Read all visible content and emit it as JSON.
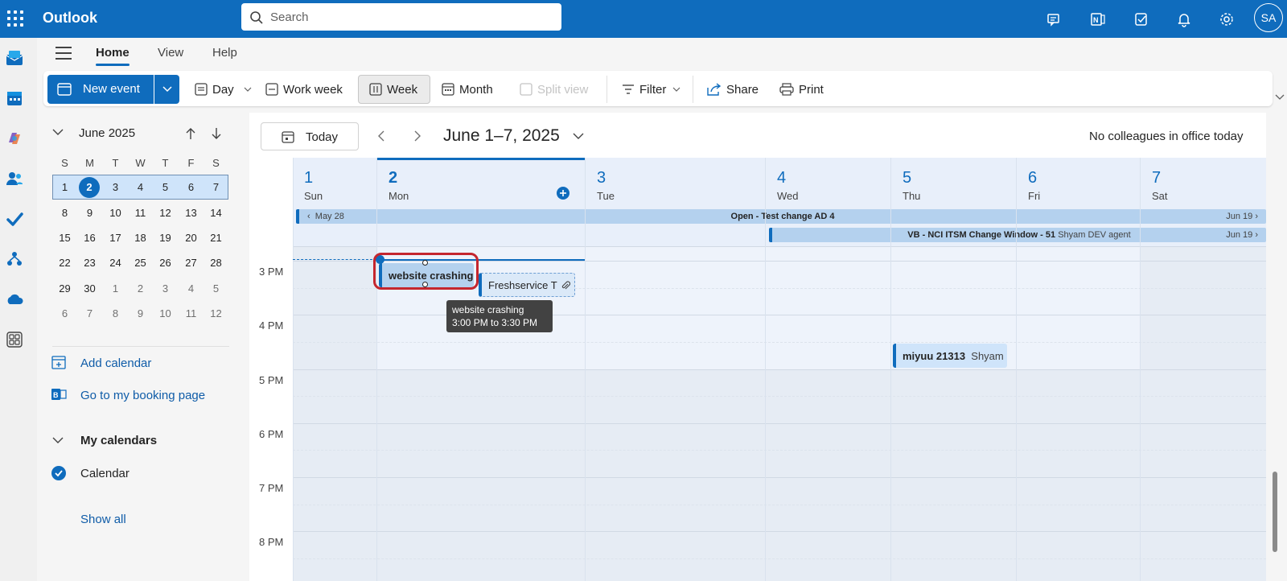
{
  "app": {
    "name": "Outlook",
    "user_initials": "SA"
  },
  "search": {
    "placeholder": "Search"
  },
  "menu": {
    "tabs": [
      "Home",
      "View",
      "Help"
    ],
    "active": "Home"
  },
  "ribbon": {
    "new_event": "New event",
    "day": "Day",
    "work_week": "Work week",
    "week": "Week",
    "month": "Month",
    "split_view": "Split view",
    "filter": "Filter",
    "share": "Share",
    "print": "Print"
  },
  "mini_calendar": {
    "title": "June 2025",
    "dow": [
      "S",
      "M",
      "T",
      "W",
      "T",
      "F",
      "S"
    ],
    "weeks": [
      [
        "1",
        "2",
        "3",
        "4",
        "5",
        "6",
        "7"
      ],
      [
        "8",
        "9",
        "10",
        "11",
        "12",
        "13",
        "14"
      ],
      [
        "15",
        "16",
        "17",
        "18",
        "19",
        "20",
        "21"
      ],
      [
        "22",
        "23",
        "24",
        "25",
        "26",
        "27",
        "28"
      ],
      [
        "29",
        "30",
        "1",
        "2",
        "3",
        "4",
        "5"
      ],
      [
        "6",
        "7",
        "8",
        "9",
        "10",
        "11",
        "12"
      ]
    ]
  },
  "nav_links": {
    "add_calendar": "Add calendar",
    "booking_page": "Go to my booking page"
  },
  "my_calendars": {
    "title": "My calendars",
    "calendar": "Calendar",
    "show_all": "Show all"
  },
  "calendar": {
    "today": "Today",
    "range": "June 1–7, 2025",
    "colleagues": "No colleagues in office today",
    "days": [
      {
        "num": "1",
        "name": "Sun"
      },
      {
        "num": "2",
        "name": "Mon"
      },
      {
        "num": "3",
        "name": "Tue"
      },
      {
        "num": "4",
        "name": "Wed"
      },
      {
        "num": "5",
        "name": "Thu"
      },
      {
        "num": "6",
        "name": "Fri"
      },
      {
        "num": "7",
        "name": "Sat"
      }
    ],
    "times": [
      "3 PM",
      "4 PM",
      "5 PM",
      "6 PM",
      "7 PM",
      "8 PM"
    ],
    "allday": [
      {
        "left": "May 28",
        "title": "Open - Test change AD 4",
        "right": "Jun 19"
      },
      {
        "title": "VB - NCI ITSM Change Window - 51",
        "organizer": "Shyam DEV agent",
        "right": "Jun 19"
      }
    ],
    "events": [
      {
        "title": "website crashing"
      },
      {
        "title": "Freshservice T"
      },
      {
        "title": "miyuu 21313",
        "organizer": "Shyam"
      }
    ],
    "tooltip": {
      "title": "website crashing",
      "time": "3:00 PM to 3:30 PM"
    }
  },
  "colors": {
    "brand": "#0f6cbd",
    "event_bg": "#cfe4fa",
    "selection_ring": "#c4262e"
  }
}
